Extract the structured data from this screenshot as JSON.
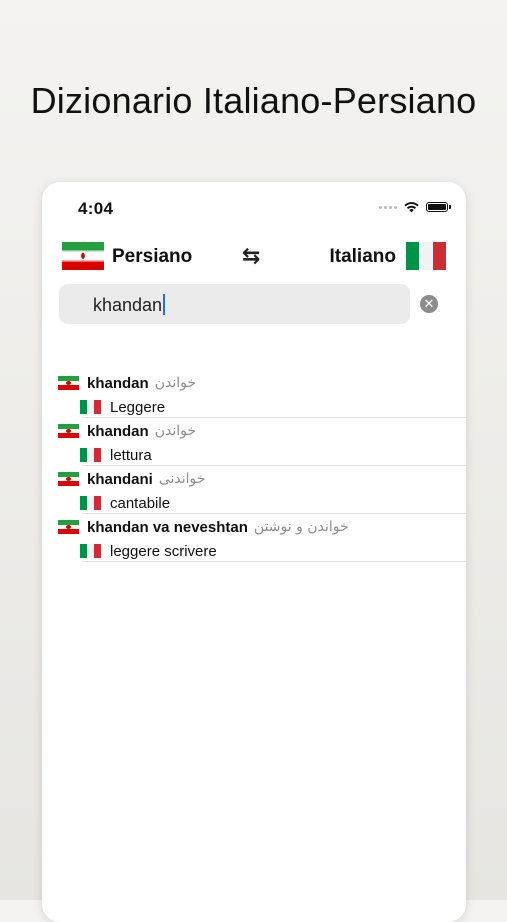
{
  "headline": "Dizionario Italiano-Persiano",
  "status_bar": {
    "time": "4:04"
  },
  "lang_bar": {
    "source_lang": "Persiano",
    "target_lang": "Italiano",
    "swap_symbol": "⇆"
  },
  "search": {
    "value": "khandan",
    "clear_symbol": "✕"
  },
  "results": [
    {
      "term": "khandan",
      "persian": "خواندن",
      "translation": "Leggere"
    },
    {
      "term": "khandan",
      "persian": "خواندن",
      "translation": "lettura"
    },
    {
      "term": "khandani",
      "persian": "خواندنی",
      "translation": "cantabile"
    },
    {
      "term": "khandan va neveshtan",
      "persian": "خواندن و نوشتن",
      "translation": "leggere scrivere"
    }
  ],
  "colors": {
    "iran_green": "#239f40",
    "iran_red": "#da0000",
    "italy_green": "#009246",
    "italy_red": "#ce2b37",
    "caret": "#1f6fe6"
  },
  "icons": [
    "wifi-icon",
    "battery-icon",
    "swap-icon",
    "clear-icon",
    "iran-flag-icon",
    "italy-flag-icon"
  ]
}
